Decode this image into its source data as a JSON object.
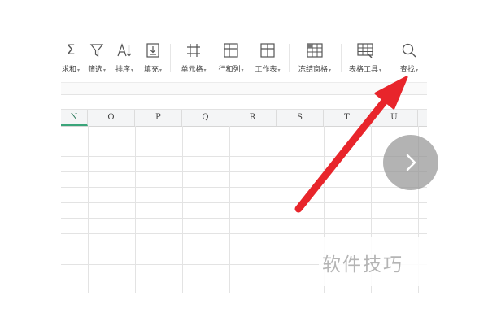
{
  "toolbar": {
    "items": [
      {
        "icon": "sum-icon",
        "label": "求和"
      },
      {
        "icon": "filter-icon",
        "label": "筛选"
      },
      {
        "icon": "sort-icon",
        "label": "排序"
      },
      {
        "icon": "fill-icon",
        "label": "填充"
      },
      {
        "icon": "cell-icon",
        "label": "单元格"
      },
      {
        "icon": "row-col-icon",
        "label": "行和列"
      },
      {
        "icon": "worksheet-icon",
        "label": "工作表"
      },
      {
        "icon": "freeze-panes-icon",
        "label": "冻结窗格"
      },
      {
        "icon": "table-tools-icon",
        "label": "表格工具"
      },
      {
        "icon": "search-icon",
        "label": "查找"
      }
    ]
  },
  "sheet": {
    "columns": [
      "N",
      "O",
      "P",
      "Q",
      "R",
      "S",
      "T",
      "U"
    ],
    "active_column": "N"
  },
  "next_button": {
    "icon": "chevron-right-icon"
  },
  "watermark": {
    "text": "软件技巧"
  },
  "annotation": {
    "type": "red-arrow",
    "color": "#e8252b",
    "points_to": "查找"
  }
}
